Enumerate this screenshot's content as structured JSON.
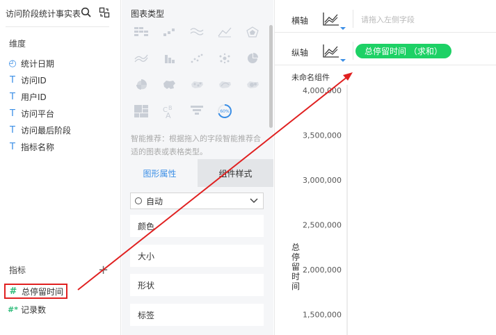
{
  "left_panel": {
    "title": "访问阶段统计事实表",
    "dimensions_label": "维度",
    "dimensions": [
      {
        "icon": "calendar-clock-icon",
        "glyph": "◴",
        "label": "统计日期"
      },
      {
        "icon": "text-type-icon",
        "glyph": "T",
        "label": "访问ID"
      },
      {
        "icon": "text-type-icon",
        "glyph": "T",
        "label": "用户ID"
      },
      {
        "icon": "text-type-icon",
        "glyph": "T",
        "label": "访问平台"
      },
      {
        "icon": "text-type-icon",
        "glyph": "T",
        "label": "访问最后阶段"
      },
      {
        "icon": "text-type-icon",
        "glyph": "T",
        "label": "指标名称"
      }
    ],
    "measures_label": "指标",
    "plus": "+",
    "measures": [
      {
        "icon": "hash-icon",
        "glyph": "#",
        "label": "总停留时间",
        "highlighted": true
      },
      {
        "icon": "hash-star-icon",
        "glyph": "#*",
        "label": "记录数"
      }
    ]
  },
  "middle_panel": {
    "chart_type_title": "图表类型",
    "hint": "智能推荐：根据拖入的字段智能推荐合适的图表或表格类型。",
    "gauge_label": "60%",
    "tabs": [
      {
        "label": "图形属性",
        "active": true
      },
      {
        "label": "组件样式",
        "active": false
      }
    ],
    "select_value": "自动",
    "properties": [
      "颜色",
      "大小",
      "形状",
      "标签"
    ]
  },
  "right_panel": {
    "x_axis_label": "横轴",
    "x_axis_placeholder": "请拖入左侧字段",
    "y_axis_label": "纵轴",
    "y_axis_pill": "总停留时间 （求和）",
    "component_name": "未命名组件"
  },
  "chart_data": {
    "type": "bar",
    "categories": [],
    "series": [],
    "ylabel": "总停留时间",
    "ytick_labels": [
      "4,000,000",
      "3,500,000",
      "3,000,000",
      "2,500,000",
      "2,000,000",
      "1,500,000"
    ],
    "ylim": [
      1250000,
      4000000
    ]
  },
  "colors": {
    "accent": "#3a8ee6",
    "pill": "#1dd165",
    "annotation": "#e02020"
  }
}
